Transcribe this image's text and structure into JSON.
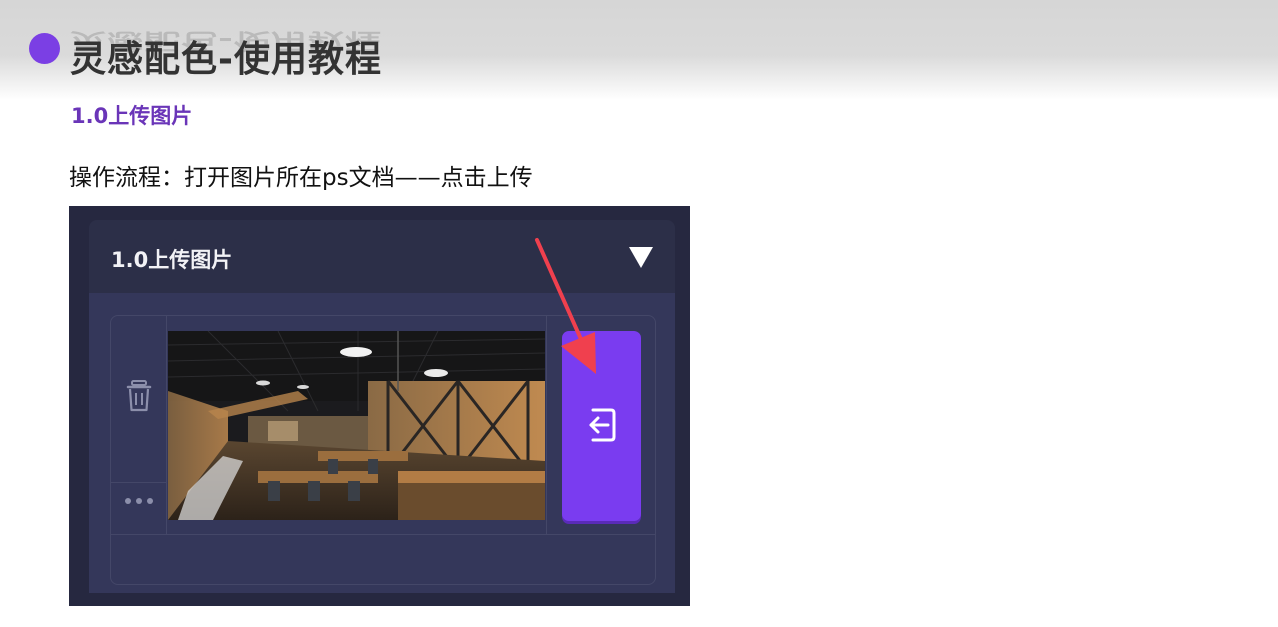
{
  "page": {
    "title": "灵感配色-使用教程",
    "section_heading": "1.0上传图片",
    "instructions": "操作流程：打开图片所在ps文档——点击上传"
  },
  "panel": {
    "header_title": "1.0上传图片",
    "collapse_icon": "triangle-down-icon",
    "side_icons": [
      "trash-icon",
      "more-dots-icon"
    ],
    "image_subject": "restaurant interior photo",
    "upload_icon": "import-icon",
    "callout_icon": "red-arrow-icon"
  },
  "colors": {
    "accent": "#7b3fe4",
    "heading": "#6a35b8",
    "panel_bg": "#262840",
    "upload_button": "#7a3cf0",
    "callout_arrow": "#f0404e"
  }
}
